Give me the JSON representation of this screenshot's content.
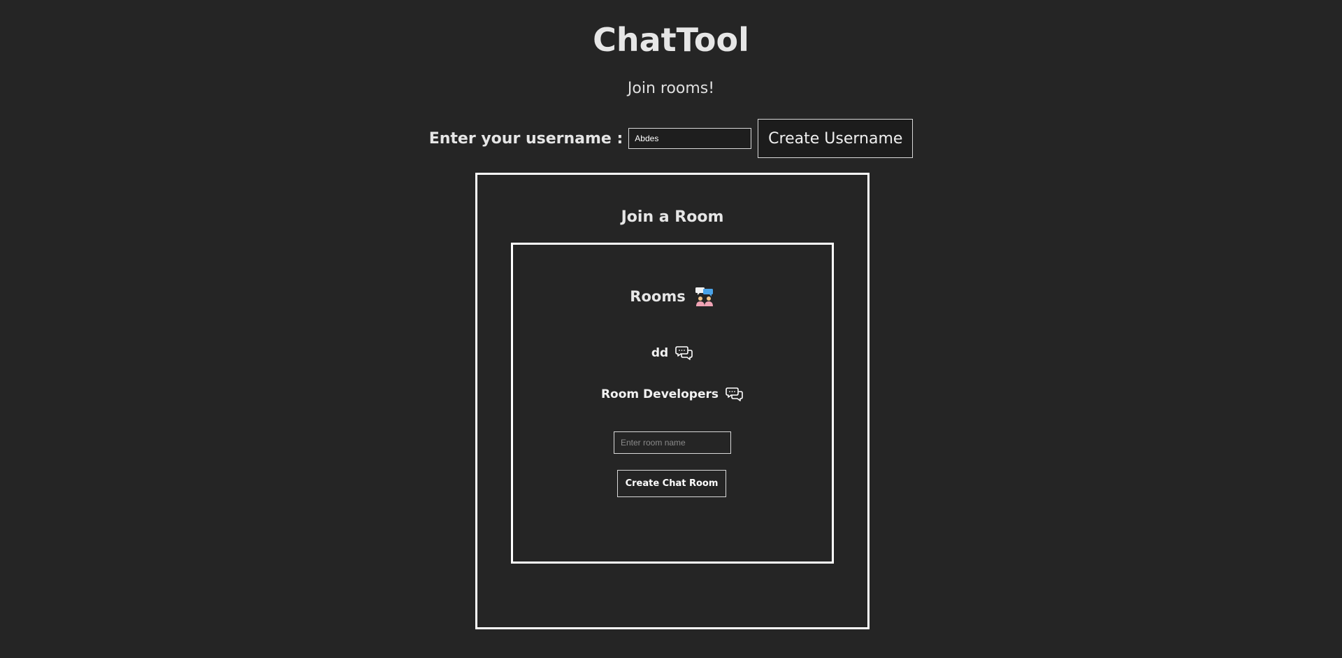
{
  "app": {
    "title": "ChatTool",
    "subtitle": "Join rooms!"
  },
  "username": {
    "label": "Enter your username :",
    "value": "Abdes",
    "button_label": "Create Username"
  },
  "join_panel": {
    "title": "Join a Room",
    "rooms_heading": "Rooms",
    "rooms_icon": "people-chat-icon",
    "rooms": [
      {
        "name": "dd",
        "icon": "chat-bubbles-icon"
      },
      {
        "name": "Room Developers",
        "icon": "chat-bubbles-icon"
      }
    ],
    "room_input_placeholder": "Enter room name",
    "create_room_label": "Create Chat Room"
  },
  "colors": {
    "background": "#252525",
    "border": "#ffffff",
    "text": "#e6e6e6",
    "people_icon_blue": "#4aa3e8",
    "people_icon_pink": "#f0a3b5"
  }
}
